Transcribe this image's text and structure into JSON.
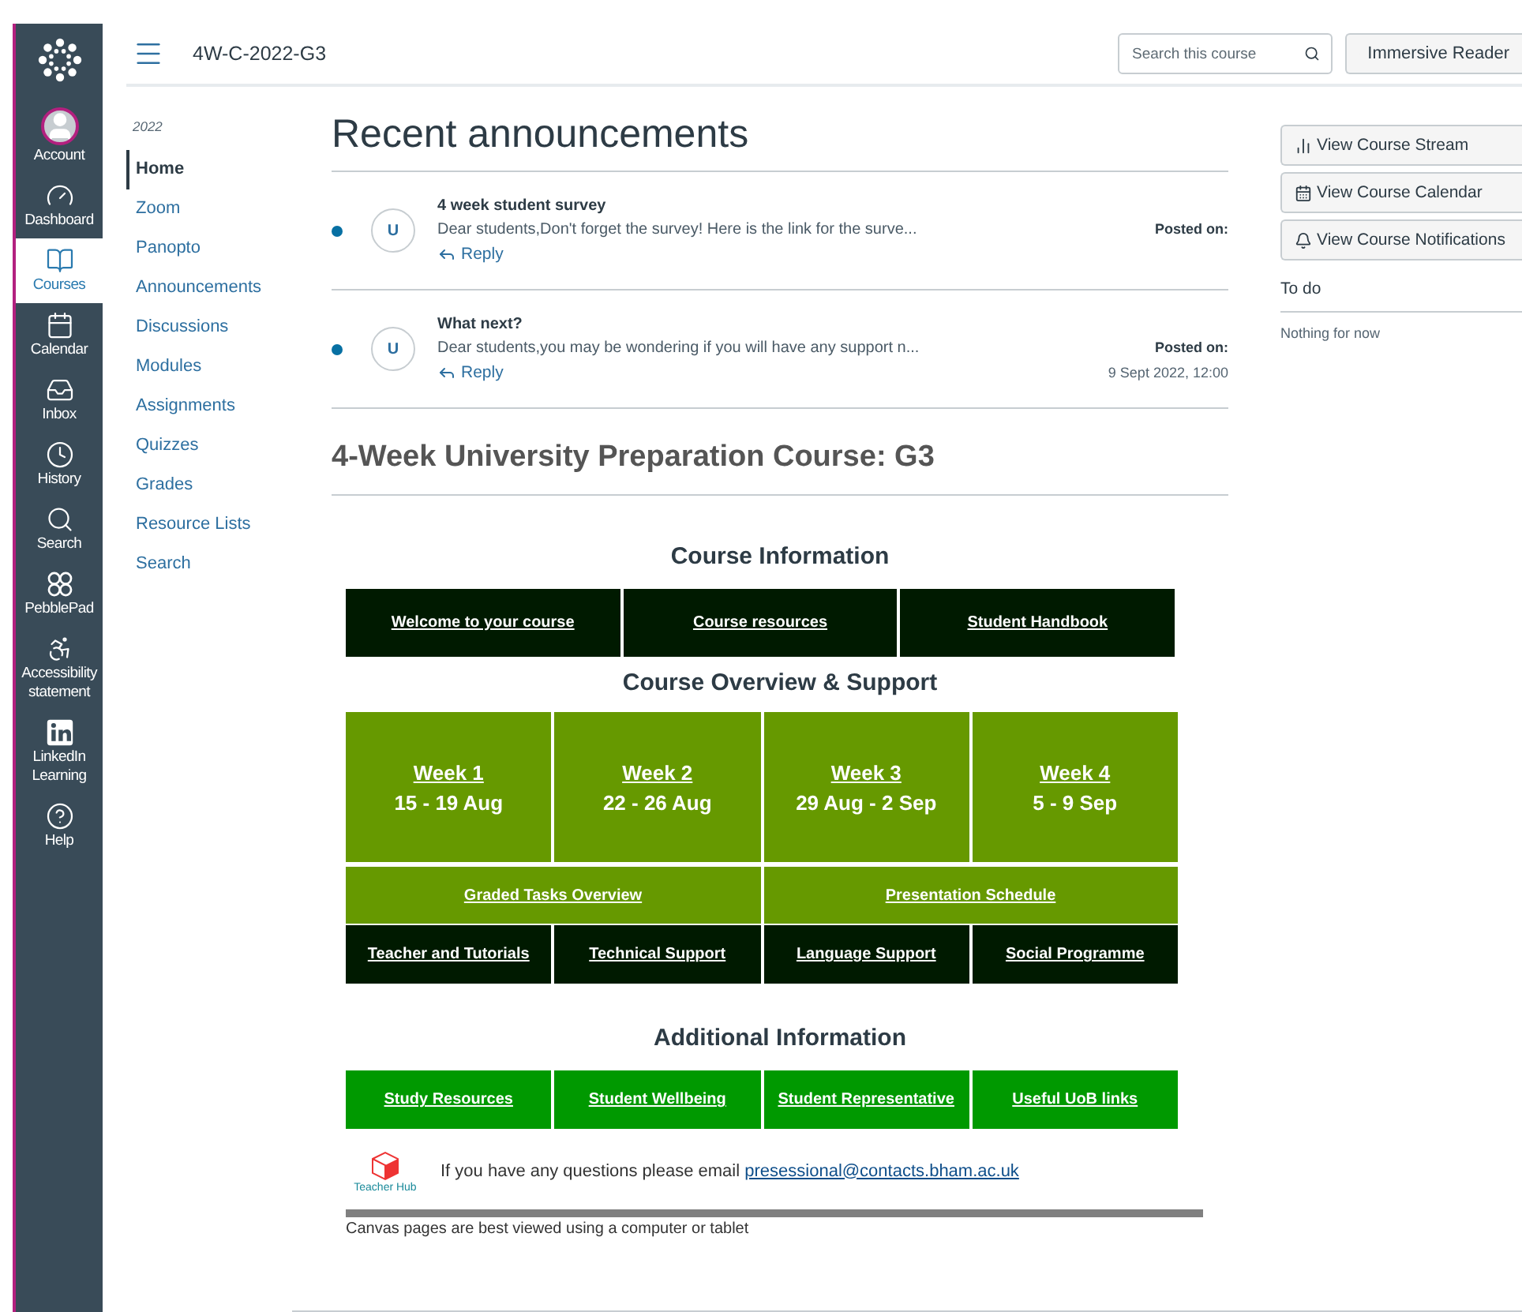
{
  "global_nav": {
    "items": [
      {
        "label": "Account",
        "selected": false
      },
      {
        "label": "Dashboard",
        "selected": false
      },
      {
        "label": "Courses",
        "selected": true
      },
      {
        "label": "Calendar",
        "selected": false
      },
      {
        "label": "Inbox",
        "selected": false
      },
      {
        "label": "History",
        "selected": false
      },
      {
        "label": "Search",
        "selected": false
      },
      {
        "label": "PebblePad",
        "selected": false
      },
      {
        "label": "Accessibility statement",
        "selected": false
      },
      {
        "label": "LinkedIn Learning",
        "selected": false
      },
      {
        "label": "Help",
        "selected": false
      }
    ]
  },
  "header": {
    "title": "4W-C-2022-G3",
    "search": {
      "placeholder": "Search this course"
    },
    "button": "Immersive Reader"
  },
  "course_nav": {
    "term": "2022",
    "items": [
      {
        "label": "Home",
        "selected": true
      },
      {
        "label": "Zoom",
        "selected": false
      },
      {
        "label": "Panopto",
        "selected": false
      },
      {
        "label": "Announcements",
        "selected": false
      },
      {
        "label": "Discussions",
        "selected": false
      },
      {
        "label": "Modules",
        "selected": false
      },
      {
        "label": "Assignments",
        "selected": false
      },
      {
        "label": "Quizzes",
        "selected": false
      },
      {
        "label": "Grades",
        "selected": false
      },
      {
        "label": "Resource Lists",
        "selected": false
      },
      {
        "label": "Search",
        "selected": false
      }
    ]
  },
  "announcements": {
    "title": "Recent announcements",
    "items": [
      {
        "title": "4 week student survey",
        "excerpt": "Dear students,Don't forget the survey! Here is the link for the surve...",
        "avatar": "U",
        "unread": true,
        "reply": "Reply",
        "posted_label": "Posted on:"
      },
      {
        "title": "What next?",
        "excerpt": "Dear students,you may be wondering if you will have any support n...",
        "avatar": "U",
        "unread": true,
        "reply": "Reply",
        "posted_label": "Posted on:",
        "posted_date": "9 Sept 2022, 12:00"
      }
    ]
  },
  "course_title": "4-Week University Preparation Course: G3",
  "course_information": {
    "heading": "Course Information",
    "links": [
      "Welcome to your course",
      "Course resources",
      "Student Handbook"
    ]
  },
  "course_overview": {
    "heading": "Course Overview & Support",
    "weeks": [
      {
        "label": "Week 1",
        "dates": "15 - 19 Aug"
      },
      {
        "label": "Week 2",
        "dates": "22 - 26 Aug"
      },
      {
        "label": "Week 3",
        "dates": "29 Aug - 2 Sep"
      },
      {
        "label": "Week 4",
        "dates": "5 - 9 Sep"
      }
    ],
    "wide_links": [
      "Graded Tasks Overview",
      "Presentation Schedule"
    ],
    "support_links": [
      "Teacher and Tutorials",
      "Technical Support",
      "Language Support",
      "Social Programme"
    ]
  },
  "additional_information": {
    "heading": "Additional Information",
    "links": [
      "Study Resources",
      "Student Wellbeing",
      "Student Representative",
      "Useful UoB links"
    ]
  },
  "contact": {
    "logo_text": "Teacher Hub",
    "text": "If you have any questions please email",
    "email": "presessional@contacts.bham.ac.uk"
  },
  "footer_note": "Canvas pages are best viewed using a computer or tablet",
  "sidebar": {
    "buttons": [
      "View Course Stream",
      "View Course Calendar",
      "View Course Notifications"
    ],
    "todo": {
      "heading": "To do",
      "empty": "Nothing for now"
    }
  }
}
